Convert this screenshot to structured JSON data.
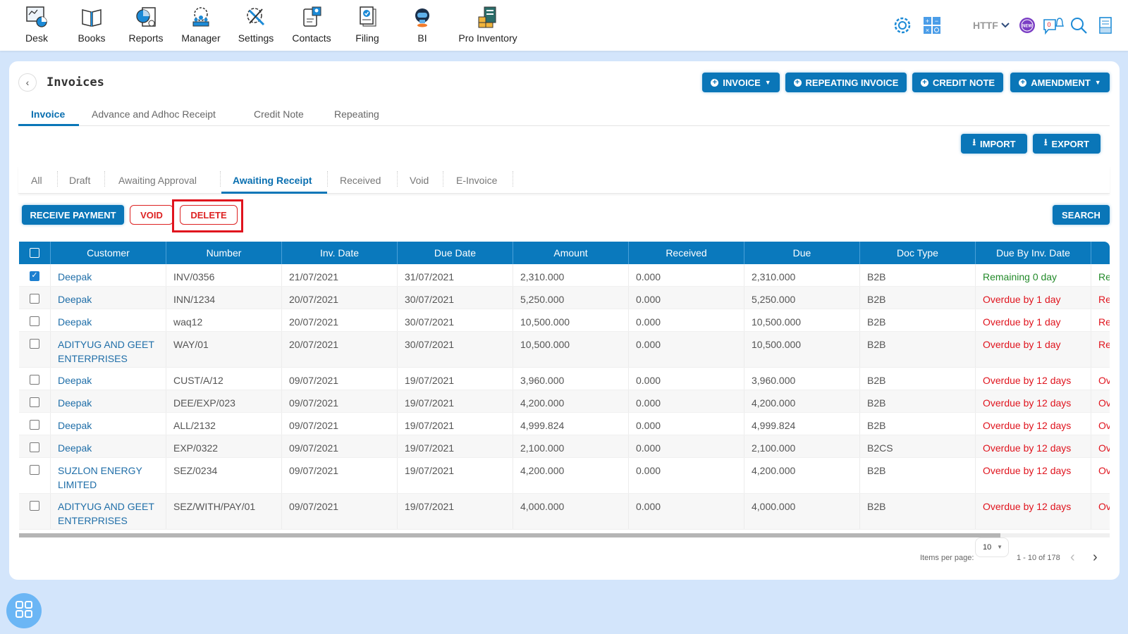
{
  "topnav": {
    "items": [
      {
        "label": "Desk",
        "icon": "desk-icon"
      },
      {
        "label": "Books",
        "icon": "books-icon"
      },
      {
        "label": "Reports",
        "icon": "reports-icon"
      },
      {
        "label": "Manager",
        "icon": "manager-icon"
      },
      {
        "label": "Settings",
        "icon": "settings-icon"
      },
      {
        "label": "Contacts",
        "icon": "contacts-icon"
      },
      {
        "label": "Filing",
        "icon": "filing-icon"
      },
      {
        "label": "BI",
        "icon": "bi-robot-icon"
      },
      {
        "label": "Pro Inventory",
        "icon": "pro-inventory-icon"
      }
    ],
    "right": {
      "company": "HTTF",
      "notification_count": "0",
      "new_badge": "NEW"
    }
  },
  "page": {
    "title": "Invoices",
    "actions": {
      "invoice": "INVOICE",
      "repeating_invoice": "REPEATING INVOICE",
      "credit_note": "CREDIT NOTE",
      "amendment": "AMENDMENT",
      "import": "IMPORT",
      "export": "EXPORT"
    },
    "tabs": [
      "Invoice",
      "Advance and Adhoc Receipt",
      "Credit Note",
      "Repeating"
    ],
    "active_tab": "Invoice",
    "status_tabs": [
      "All",
      "Draft",
      "Awaiting Approval",
      "Awaiting Receipt",
      "Received",
      "Void",
      "E-Invoice"
    ],
    "active_status_tab": "Awaiting Receipt",
    "bulk_actions": {
      "receive_payment": "RECEIVE PAYMENT",
      "void": "VOID",
      "delete": "DELETE",
      "search": "SEARCH"
    }
  },
  "table": {
    "columns": [
      "Customer",
      "Number",
      "Inv. Date",
      "Due Date",
      "Amount",
      "Received",
      "Due",
      "Doc Type",
      "Due By Inv. Date",
      ""
    ],
    "rows": [
      {
        "checked": true,
        "customer": "Deepak",
        "number": "INV/0356",
        "inv_date": "21/07/2021",
        "due_date": "31/07/2021",
        "amount": "2,310.000",
        "received": "0.000",
        "due": "2,310.000",
        "doc_type": "B2B",
        "due_by": "Remaining 0 day",
        "status": "green",
        "extra": "Re"
      },
      {
        "checked": false,
        "customer": "Deepak",
        "number": "INN/1234",
        "inv_date": "20/07/2021",
        "due_date": "30/07/2021",
        "amount": "5,250.000",
        "received": "0.000",
        "due": "5,250.000",
        "doc_type": "B2B",
        "due_by": "Overdue by 1 day",
        "status": "red",
        "extra": "Re"
      },
      {
        "checked": false,
        "customer": "Deepak",
        "number": "waq12",
        "inv_date": "20/07/2021",
        "due_date": "30/07/2021",
        "amount": "10,500.000",
        "received": "0.000",
        "due": "10,500.000",
        "doc_type": "B2B",
        "due_by": "Overdue by 1 day",
        "status": "red",
        "extra": "Re"
      },
      {
        "checked": false,
        "customer": "ADITYUG AND GEET ENTERPRISES",
        "number": "WAY/01",
        "inv_date": "20/07/2021",
        "due_date": "30/07/2021",
        "amount": "10,500.000",
        "received": "0.000",
        "due": "10,500.000",
        "doc_type": "B2B",
        "due_by": "Overdue by 1 day",
        "status": "red",
        "extra": "Re"
      },
      {
        "checked": false,
        "customer": "Deepak",
        "number": "CUST/A/12",
        "inv_date": "09/07/2021",
        "due_date": "19/07/2021",
        "amount": "3,960.000",
        "received": "0.000",
        "due": "3,960.000",
        "doc_type": "B2B",
        "due_by": "Overdue by 12 days",
        "status": "red",
        "extra": "Ov"
      },
      {
        "checked": false,
        "customer": "Deepak",
        "number": "DEE/EXP/023",
        "inv_date": "09/07/2021",
        "due_date": "19/07/2021",
        "amount": "4,200.000",
        "received": "0.000",
        "due": "4,200.000",
        "doc_type": "B2B",
        "due_by": "Overdue by 12 days",
        "status": "red",
        "extra": "Ov"
      },
      {
        "checked": false,
        "customer": "Deepak",
        "number": "ALL/2132",
        "inv_date": "09/07/2021",
        "due_date": "19/07/2021",
        "amount": "4,999.824",
        "received": "0.000",
        "due": "4,999.824",
        "doc_type": "B2B",
        "due_by": "Overdue by 12 days",
        "status": "red",
        "extra": "Ov"
      },
      {
        "checked": false,
        "customer": "Deepak",
        "number": "EXP/0322",
        "inv_date": "09/07/2021",
        "due_date": "19/07/2021",
        "amount": "2,100.000",
        "received": "0.000",
        "due": "2,100.000",
        "doc_type": "B2CS",
        "due_by": "Overdue by 12 days",
        "status": "red",
        "extra": "Ov"
      },
      {
        "checked": false,
        "customer": "SUZLON ENERGY LIMITED",
        "number": "SEZ/0234",
        "inv_date": "09/07/2021",
        "due_date": "19/07/2021",
        "amount": "4,200.000",
        "received": "0.000",
        "due": "4,200.000",
        "doc_type": "B2B",
        "due_by": "Overdue by 12 days",
        "status": "red",
        "extra": "Ov"
      },
      {
        "checked": false,
        "customer": "ADITYUG AND GEET ENTERPRISES",
        "number": "SEZ/WITH/PAY/01",
        "inv_date": "09/07/2021",
        "due_date": "19/07/2021",
        "amount": "4,000.000",
        "received": "0.000",
        "due": "4,000.000",
        "doc_type": "B2B",
        "due_by": "Overdue by 12 days",
        "status": "red",
        "extra": "Ov"
      }
    ]
  },
  "pagination": {
    "items_per_page_label": "Items per page:",
    "items_per_page": "10",
    "range": "1 - 10 of 178"
  },
  "colors": {
    "primary": "#0a76b8",
    "danger": "#e0141e",
    "success": "#238a2a",
    "background": "#d3e5fb"
  }
}
